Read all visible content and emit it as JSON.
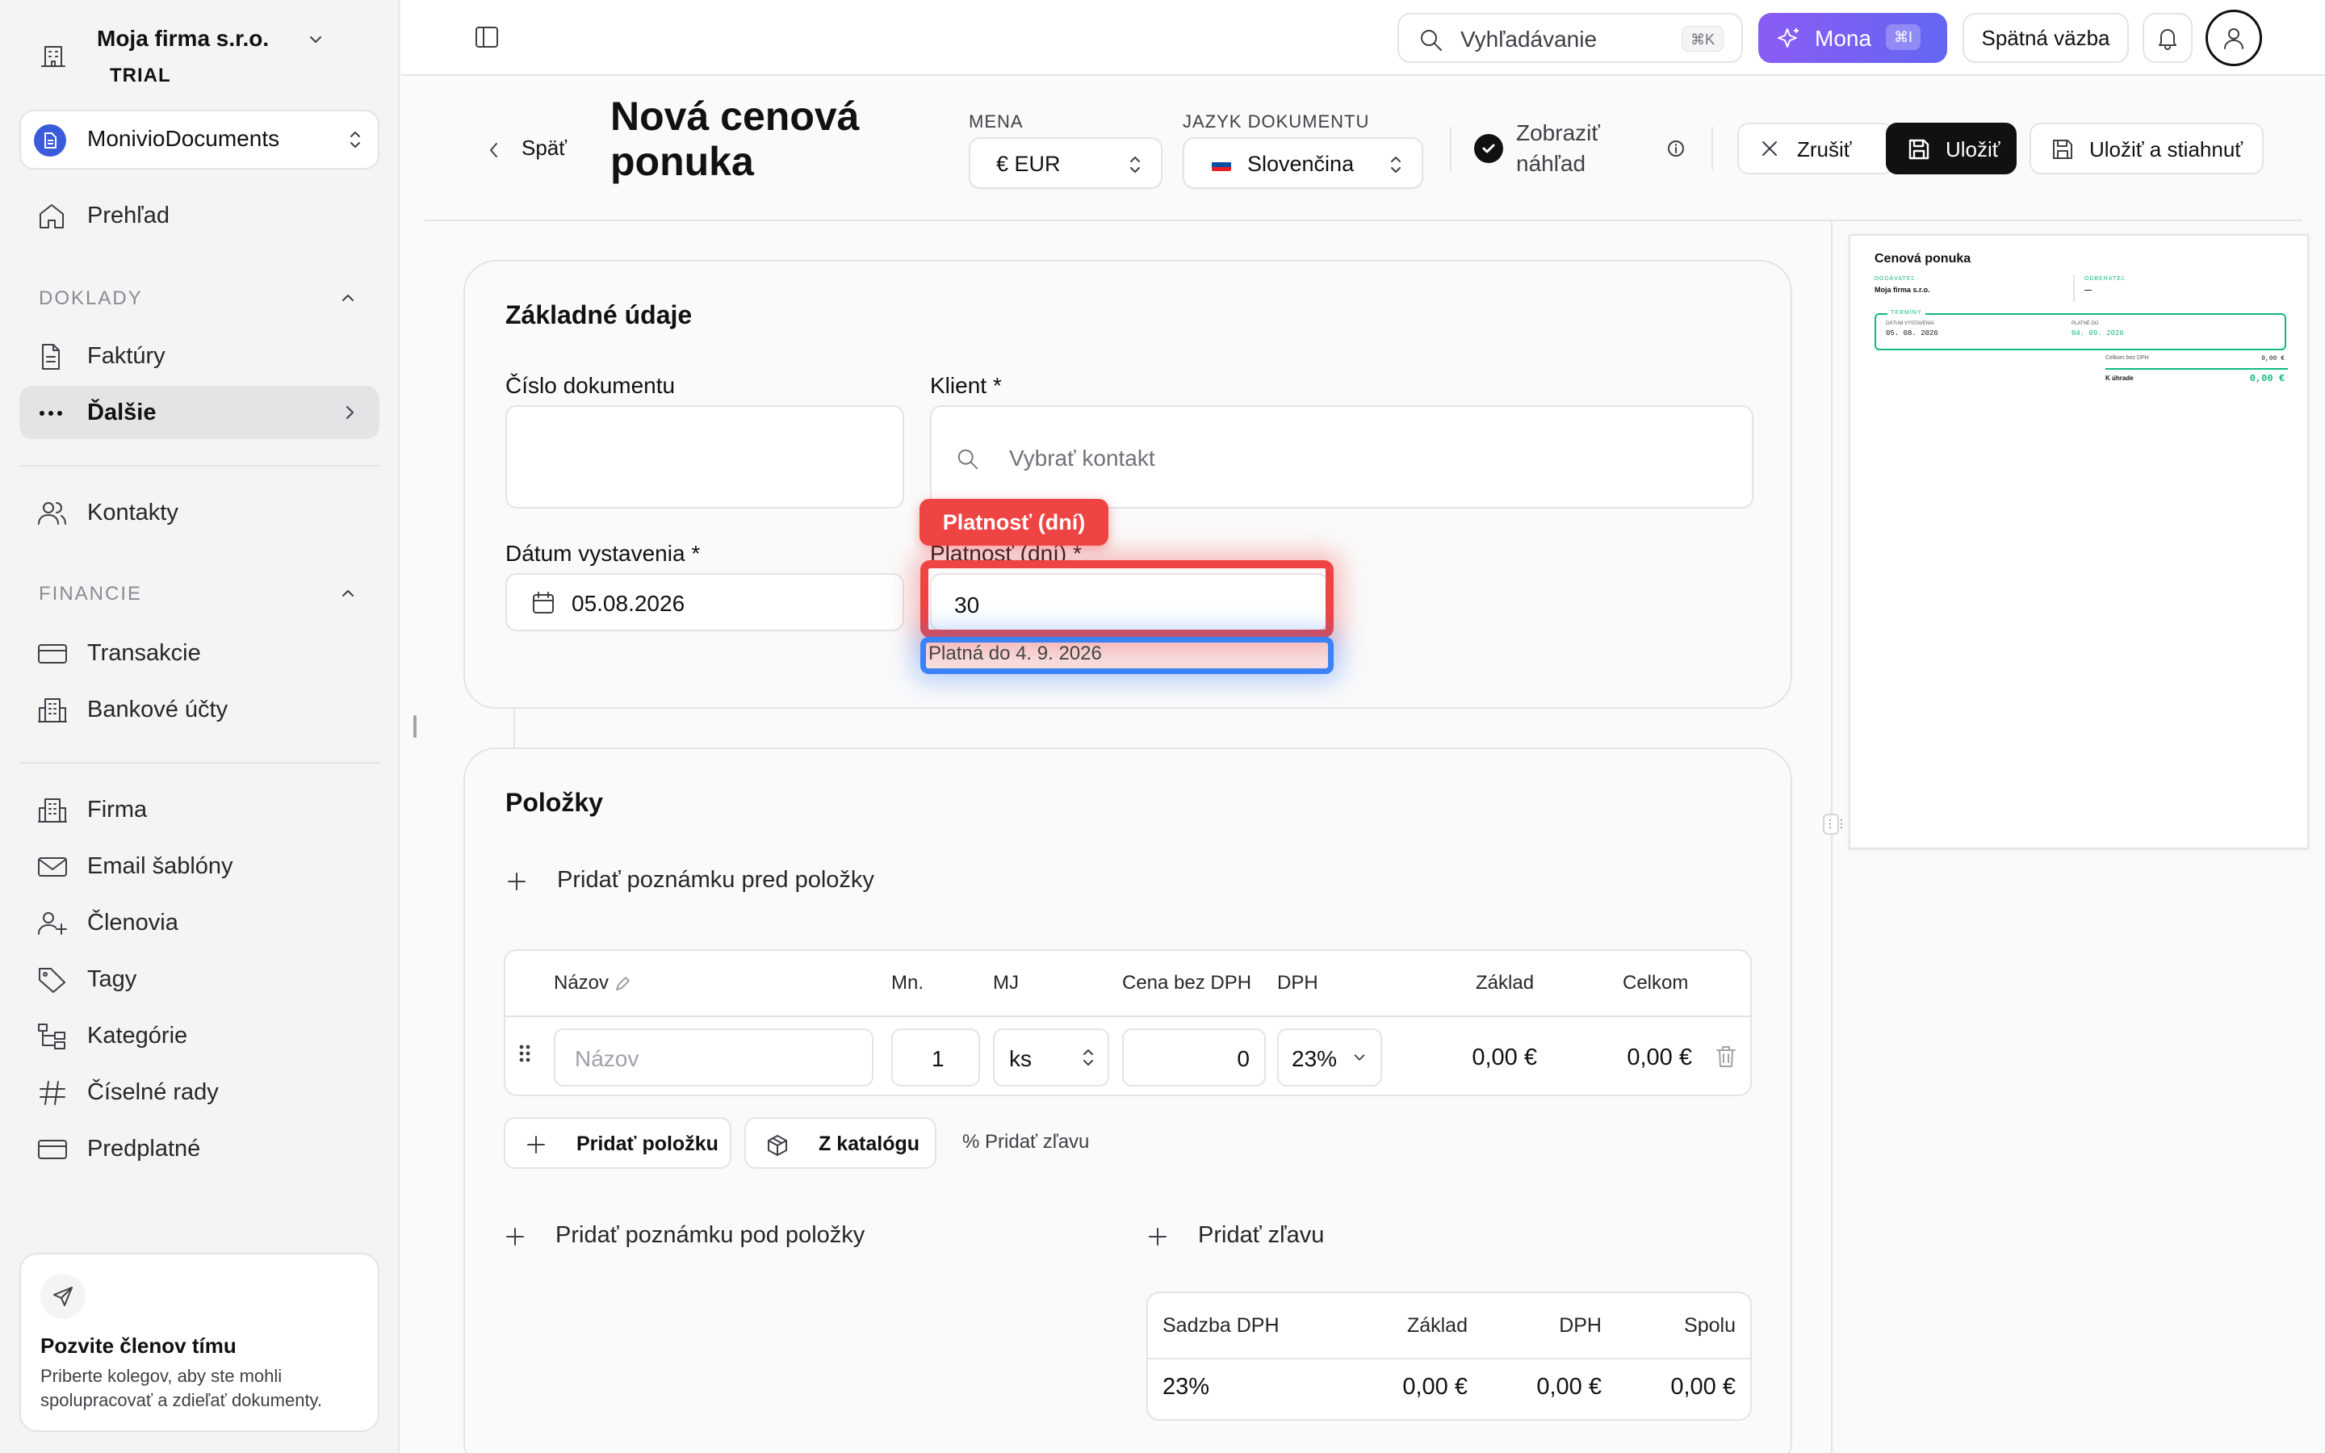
{
  "sidebar": {
    "org": {
      "name": "Moja firma s.r.o.",
      "plan": "TRIAL"
    },
    "workspace": "MonivioDocuments",
    "overview": "Prehľad",
    "section_docs": "DOKLADY",
    "invoices": "Faktúry",
    "more": "Ďalšie",
    "contacts": "Kontakty",
    "section_finance": "FINANCIE",
    "transactions": "Transakcie",
    "bank_accounts": "Bankové účty",
    "company": "Firma",
    "email_templates": "Email šablóny",
    "members": "Členovia",
    "tags": "Tagy",
    "categories": "Kategórie",
    "number_series": "Číselné rady",
    "subscription": "Predplatné",
    "invite": {
      "title": "Pozvite členov tímu",
      "desc": "Priberte kolegov, aby ste mohli spolupracovať a zdieľať dokumenty."
    }
  },
  "topbar": {
    "search_placeholder": "Vyhľadávanie",
    "search_kbd": "⌘K",
    "mona_label": "Mona",
    "mona_kbd": "⌘I",
    "feedback": "Spätná väzba"
  },
  "header": {
    "back": "Späť",
    "title": "Nová cenová ponuka",
    "currency_label": "MENA",
    "currency_value": "€ EUR",
    "lang_label": "JAZYK DOKUMENTU",
    "lang_value": "Slovenčina",
    "preview_toggle": "Zobraziť náhľad",
    "cancel": "Zrušiť",
    "save": "Uložiť",
    "save_download": "Uložiť a stiahnuť"
  },
  "basics": {
    "title": "Základné údaje",
    "doc_number_label": "Číslo dokumentu",
    "doc_number_value": "",
    "client_label": "Klient *",
    "client_placeholder": "Vybrať kontakt",
    "issue_date_label": "Dátum vystavenia *",
    "issue_date_value": "05.08.2026",
    "validity_label": "Platnosť (dní) *",
    "validity_value": "30",
    "valid_until": "Platná do 4. 9. 2026",
    "highlight_tag": "Platnosť (dní)"
  },
  "items": {
    "title": "Položky",
    "add_note_before": "Pridať poznámku pred položky",
    "columns": {
      "name": "Názov",
      "qty": "Mn.",
      "unit": "MJ",
      "price": "Cena bez DPH",
      "vat": "DPH",
      "base": "Základ",
      "total": "Celkom"
    },
    "rows": [
      {
        "name_placeholder": "Názov",
        "qty": "1",
        "unit": "ks",
        "price": "0",
        "vat": "23%",
        "base": "0,00 €",
        "total": "0,00 €"
      }
    ],
    "add_item": "Pridať položku",
    "from_catalog": "Z katalógu",
    "add_discount_small": "% Pridať zľavu",
    "add_note_after": "Pridať poznámku pod položky",
    "add_discount": "Pridať zľavu",
    "vat_table": {
      "headers": [
        "Sadzba DPH",
        "Základ",
        "DPH",
        "Spolu"
      ],
      "row": [
        "23%",
        "0,00 €",
        "0,00 €",
        "0,00 €"
      ]
    }
  },
  "preview": {
    "title": "Cenová ponuka",
    "supplier_label": "DODÁVATEĽ",
    "supplier": "Moja firma s.r.o.",
    "customer_label": "ODBERATEĽ",
    "customer": "—",
    "terms_label": "TERMÍNY",
    "issue_label": "DÁTUM VYSTAVENIA",
    "issue": "05. 08. 2026",
    "valid_label": "PLATNÉ DO",
    "valid": "04. 09. 2026",
    "total_excl_label": "Celkom bez DPH",
    "total_excl": "0,00 €",
    "due_label": "K úhrade",
    "due": "0,00 €"
  },
  "colors": {
    "accent": "#8b5cf6",
    "highlight_red": "#ef4444",
    "highlight_blue": "#3b82f6",
    "preview_green": "#10b981"
  }
}
